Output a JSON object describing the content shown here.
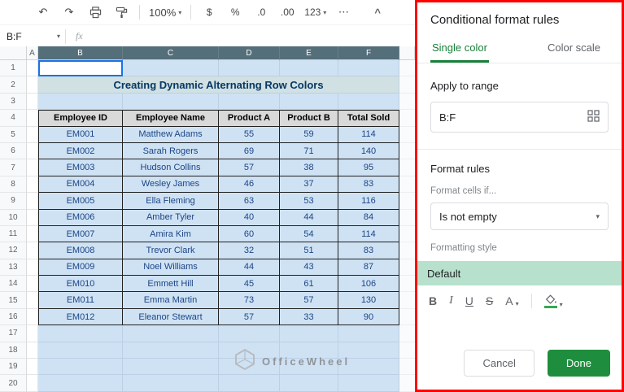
{
  "icons": {
    "undo": "↶",
    "redo": "↷",
    "caret": "▾",
    "more": "⋯",
    "collapse": "^"
  },
  "toolbar": {
    "zoom": "100%",
    "currency": "$",
    "percent": "%",
    "decimal_decrease": ".0",
    "decimal_increase": ".00",
    "more_formats": "123"
  },
  "formula_bar": {
    "name_box_value": "B:F",
    "fx_label": "fx"
  },
  "sheet": {
    "col_headers": [
      "A",
      "B",
      "C",
      "D",
      "E",
      "F"
    ],
    "row_count": 20,
    "title": "Creating Dynamic Alternating Row Colors",
    "table_headers": [
      "Employee ID",
      "Employee Name",
      "Product A",
      "Product B",
      "Total Sold"
    ],
    "table_rows": [
      [
        "EM001",
        "Matthew Adams",
        "55",
        "59",
        "114"
      ],
      [
        "EM002",
        "Sarah Rogers",
        "69",
        "71",
        "140"
      ],
      [
        "EM003",
        "Hudson Collins",
        "57",
        "38",
        "95"
      ],
      [
        "EM004",
        "Wesley James",
        "46",
        "37",
        "83"
      ],
      [
        "EM005",
        "Ella Fleming",
        "63",
        "53",
        "116"
      ],
      [
        "EM006",
        "Amber Tyler",
        "40",
        "44",
        "84"
      ],
      [
        "EM007",
        "Amira Kim",
        "60",
        "54",
        "114"
      ],
      [
        "EM008",
        "Trevor Clark",
        "32",
        "51",
        "83"
      ],
      [
        "EM009",
        "Noel Williams",
        "44",
        "43",
        "87"
      ],
      [
        "EM010",
        "Emmett Hill",
        "45",
        "61",
        "106"
      ],
      [
        "EM011",
        "Emma Martin",
        "73",
        "57",
        "130"
      ],
      [
        "EM012",
        "Eleanor Stewart",
        "57",
        "33",
        "90"
      ]
    ],
    "watermark": "OfficeWheel"
  },
  "panel": {
    "title": "Conditional format rules",
    "tabs": [
      {
        "label": "Single color",
        "active": true
      },
      {
        "label": "Color scale",
        "active": false
      }
    ],
    "apply_to_range_label": "Apply to range",
    "range_value": "B:F",
    "format_rules_label": "Format rules",
    "format_cells_if_label": "Format cells if...",
    "condition_value": "Is not empty",
    "formatting_style_label": "Formatting style",
    "style_preview_label": "Default",
    "format_buttons": {
      "bold": "B",
      "italic": "I",
      "underline": "U",
      "strikethrough": "S",
      "text_color": "A"
    },
    "cancel_label": "Cancel",
    "done_label": "Done"
  },
  "colors": {
    "accent_green": "#188038",
    "done_green": "#1e8e3e",
    "selection_blue": "#1a73e8",
    "table_blue": "#cfe2f3",
    "title_teal": "#d0e0e3",
    "header_gray": "#d9d9d9",
    "preview_green": "#b7e1cd",
    "annotation_red": "#ff0000"
  }
}
